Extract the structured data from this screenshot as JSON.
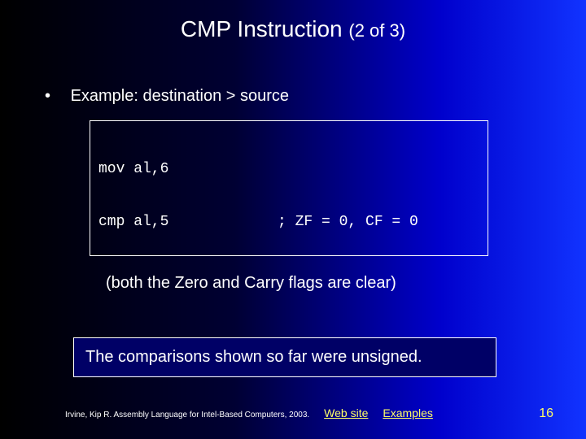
{
  "title": {
    "main": "CMP Instruction",
    "sub": " (2 of 3)"
  },
  "bullet": {
    "marker": "•",
    "text": "Example: destination > source"
  },
  "code": {
    "line1_left": "mov al,6",
    "line2_left": "cmp al,5",
    "line2_right": "; ZF = 0, CF = 0"
  },
  "note": "(both the Zero and Carry flags are clear)",
  "callout": "The comparisons shown so far were unsigned.",
  "footer": {
    "citation": "Irvine, Kip R. Assembly Language for Intel-Based Computers, 2003.",
    "link1": "Web site",
    "link2": "Examples",
    "page": "16"
  }
}
